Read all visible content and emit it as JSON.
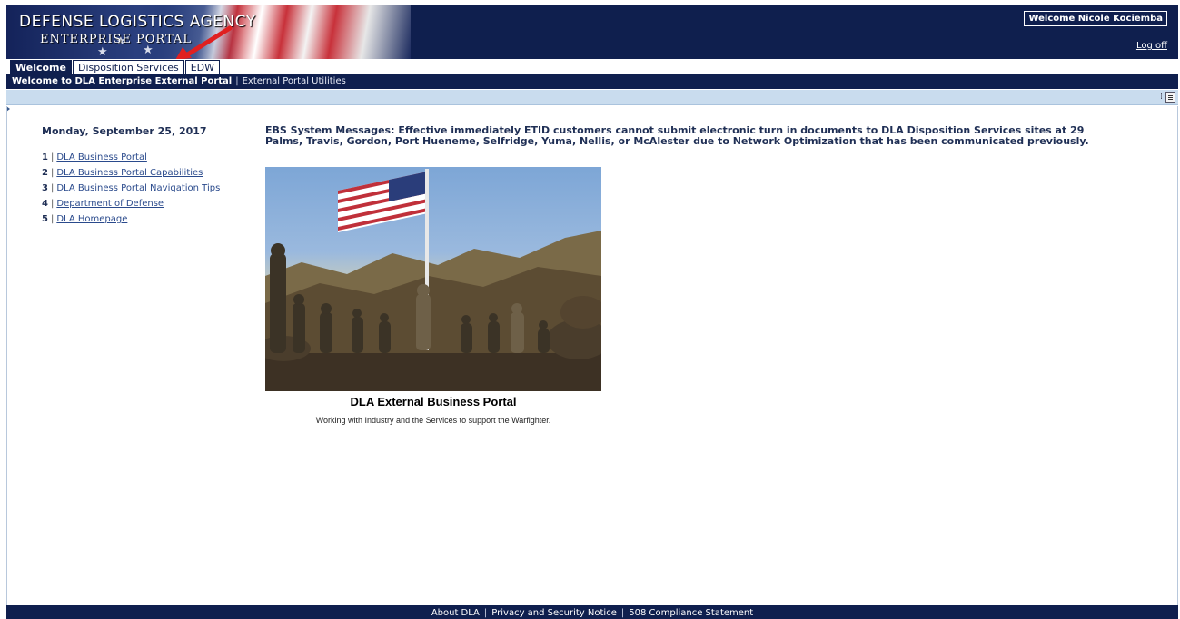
{
  "header": {
    "agency_title": "DEFENSE LOGISTICS AGENCY",
    "portal_subtitle": "ENTERPRISE PORTAL",
    "welcome_user": "Welcome Nicole Kociemba",
    "logoff_label": "Log off",
    "colors": {
      "navy": "#0f1f4e",
      "annotation_arrow": "#e02020"
    }
  },
  "tabs": [
    {
      "label": "Welcome",
      "active": true
    },
    {
      "label": "Disposition Services",
      "active": false
    },
    {
      "label": "EDW",
      "active": false
    }
  ],
  "subnav": {
    "active_label": "Welcome to DLA Enterprise External Portal",
    "separator": "|",
    "utility_label": "External Portal Utilities"
  },
  "toolbar": {
    "grip": "⁞",
    "menu_icon": "menu-icon"
  },
  "sidebar": {
    "date": "Monday, September 25, 2017",
    "links": [
      {
        "num": "1",
        "label": "DLA Business Portal"
      },
      {
        "num": "2",
        "label": "DLA Business Portal Capabilities"
      },
      {
        "num": "3",
        "label": "DLA Business Portal Navigation Tips"
      },
      {
        "num": "4",
        "label": "Department of Defense"
      },
      {
        "num": "5",
        "label": "DLA Homepage"
      }
    ]
  },
  "main": {
    "system_message": "EBS System Messages: Effective immediately ETID customers cannot submit electronic turn in documents to DLA Disposition Services sites at 29 Palms, Travis, Gordon, Port Hueneme, Selfridge, Yuma, Nellis, or McAlester due to Network Optimization that has been communicated previously.",
    "photo_caption": "DLA External Business Portal",
    "photo_subcaption": "Working with Industry and the Services to support the Warfighter."
  },
  "footer": {
    "links": [
      "About DLA",
      "Privacy and Security Notice",
      "508 Compliance Statement"
    ],
    "separator": "|"
  }
}
